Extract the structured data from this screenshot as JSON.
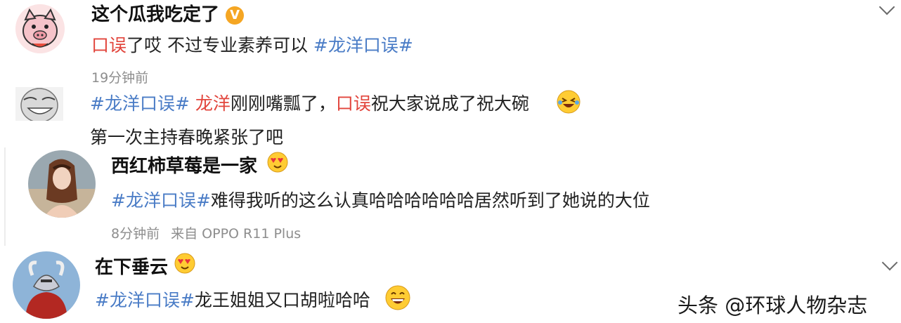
{
  "comments": [
    {
      "user": "这个瓜我吃定了",
      "verified_badge": "V",
      "text": {
        "p1": "口误",
        "p2": "了哎 不过专业素养可以 ",
        "p3": "#龙洋口误#"
      },
      "time": "19分钟前"
    },
    {
      "text": {
        "p1": "#龙洋口误#",
        "p2": " ",
        "p3": "龙洋",
        "p4": "刚刚嘴瓢了，",
        "p5": "口误",
        "p6": "祝大家说成了祝大碗"
      },
      "line2": "第一次主持春晚紧张了吧"
    },
    {
      "user": "西红柿草莓是一家",
      "text": {
        "p1": "#龙洋口误#",
        "p2": "难得我听的这么认真哈哈哈哈哈哈居然听到了她说的大位"
      },
      "time": "8分钟前",
      "source": "来自 OPPO R11 Plus"
    },
    {
      "user": "在下垂云",
      "text": {
        "p1": "#龙洋口误#",
        "p2": "龙王姐姐又口胡啦哈哈"
      }
    }
  ],
  "watermark": "头条 @环球人物杂志",
  "colors": {
    "tag": "#4a7cc6",
    "highlight": "#e2453c",
    "meta": "#8d8d8d"
  },
  "icons": [
    "pig-avatar-icon",
    "chevron-down-icon",
    "laughing-emoji-icon",
    "heart-eyes-emoji-icon",
    "grinning-emoji-icon"
  ]
}
